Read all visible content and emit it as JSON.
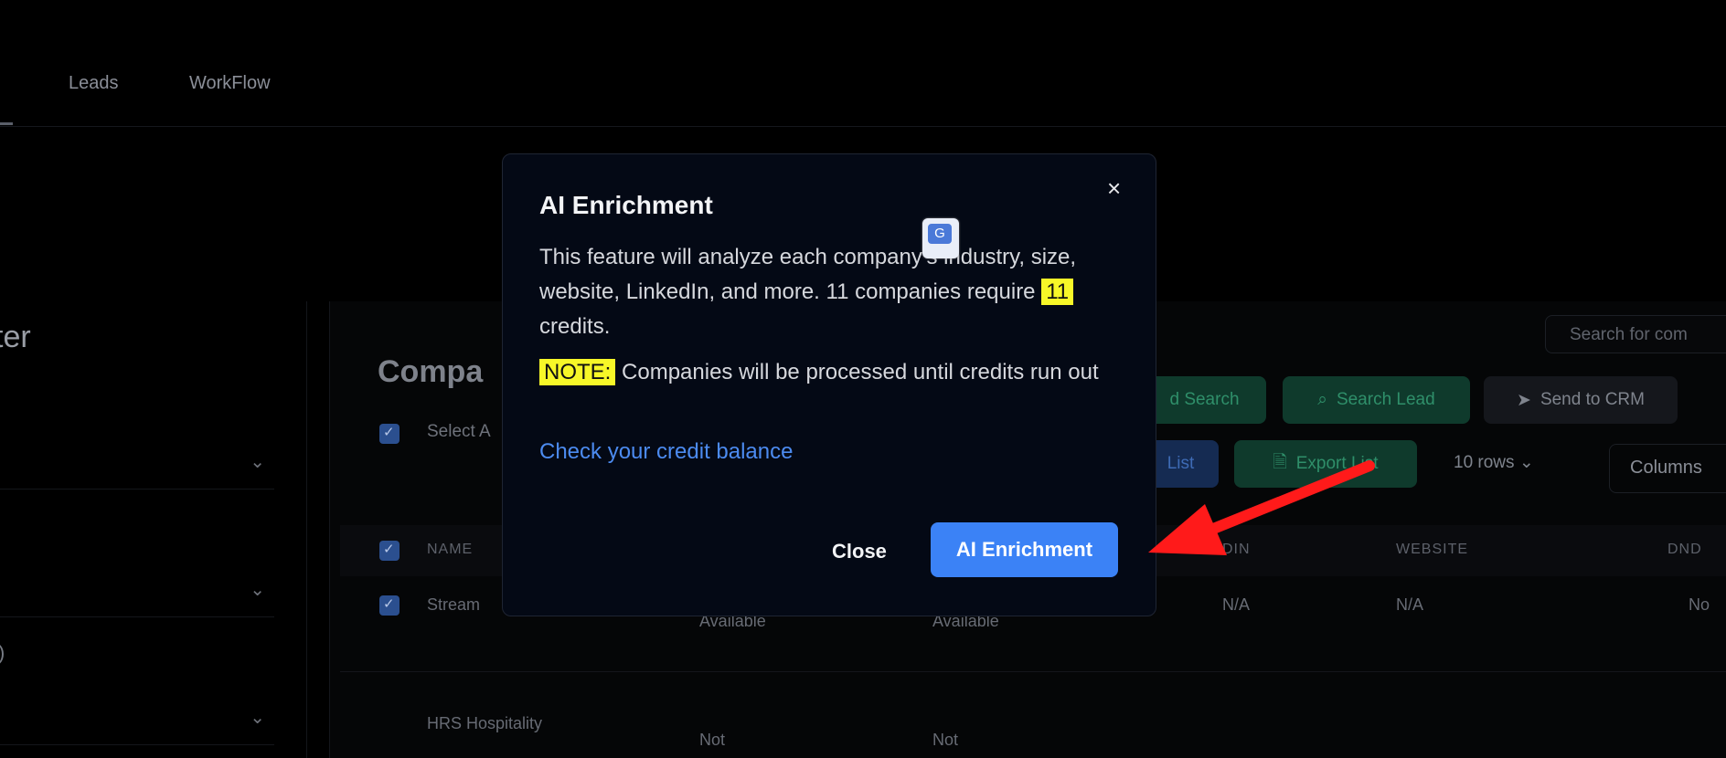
{
  "nav": {
    "tabs": [
      "Leads",
      "WorkFlow"
    ]
  },
  "sidebar": {
    "title_fragment": "ter",
    "stray_char": ")"
  },
  "main": {
    "search_placeholder": "Search for com",
    "section_title": "Compa",
    "select_all_label": "Select A",
    "buttons": {
      "load_search": "d Search",
      "search_lead": "Search Lead",
      "send_to_crm": "Send to CRM",
      "list": "List",
      "export": "Export List",
      "rows": "10 rows",
      "columns": "Columns"
    },
    "table": {
      "headers": [
        "NAME",
        "DIN",
        "WEBSITE",
        "DND"
      ],
      "rows": [
        {
          "name": "Stream",
          "col2": "Available",
          "col3": "Available",
          "din": "N/A",
          "website": "N/A",
          "dnd": "No"
        },
        {
          "name": "HRS Hospitality",
          "col2": "Not",
          "col3": "Not",
          "din": "",
          "website": "",
          "dnd": ""
        }
      ]
    }
  },
  "modal": {
    "title": "AI Enrichment",
    "body_part1": "This feature will analyze each company's industry, size, website, LinkedIn, and more. 11 companies require",
    "credits_value": "11",
    "body_part2": "credits.",
    "note_label": "NOTE:",
    "note_text": "Companies will be processed until credits run out",
    "credit_link": "Check your credit balance",
    "close_label": "Close",
    "confirm_label": "AI Enrichment",
    "close_x": "×",
    "highlight_color": "#f7f728",
    "accent_color": "#3b82f6"
  },
  "annotation": {
    "arrow_color": "#ff1a1a"
  }
}
